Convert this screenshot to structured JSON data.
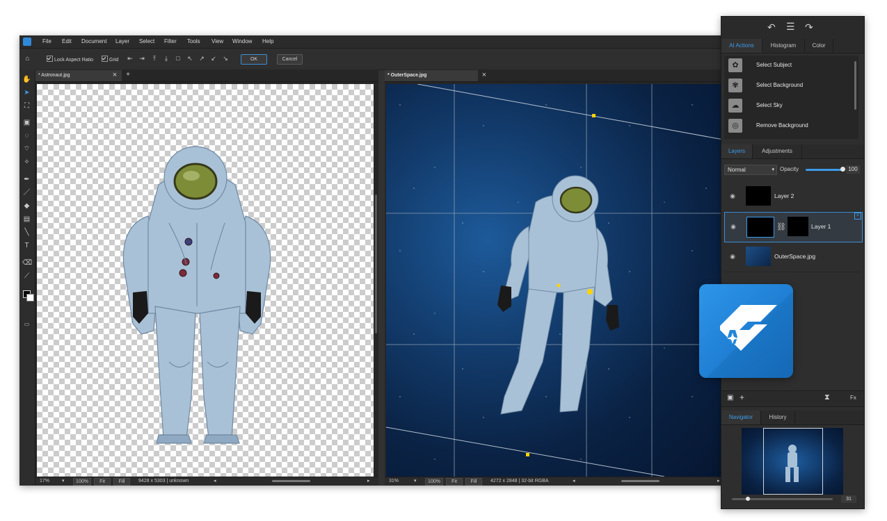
{
  "menubar": {
    "items": [
      "File",
      "Edit",
      "Document",
      "Layer",
      "Select",
      "Filter",
      "Tools",
      "View",
      "Window",
      "Help"
    ]
  },
  "options": {
    "lock_aspect_label": "Lock Aspect Ratio",
    "grid_label": "Grid",
    "ok_label": "OK",
    "cancel_label": "Cancel"
  },
  "docs": {
    "left": {
      "tab_title": "* Astronaut.jpg",
      "zoom": "17%",
      "zoom100": "100%",
      "fit": "Fit",
      "fill": "Fill",
      "info": "9428 x 5303 | unknown"
    },
    "right": {
      "tab_title": "* OuterSpace.jpg",
      "zoom": "31%",
      "zoom100": "100%",
      "fit": "Fit",
      "fill": "Fill",
      "info": "4272 x 2848 | 32-bit RGBA"
    }
  },
  "panel": {
    "top_tabs": [
      "AI Actions",
      "Histogram",
      "Color"
    ],
    "ai_actions": [
      {
        "label": "Select Subject",
        "icon": "select-subject-icon"
      },
      {
        "label": "Select Background",
        "icon": "select-background-icon"
      },
      {
        "label": "Select Sky",
        "icon": "select-sky-icon"
      },
      {
        "label": "Remove Background",
        "icon": "remove-background-icon"
      }
    ],
    "layer_tabs": [
      "Layers",
      "Adjustments"
    ],
    "blend_mode": "Normal",
    "opacity_label": "Opacity",
    "opacity_value": "100",
    "layers": [
      {
        "name": "Layer 2"
      },
      {
        "name": "Layer 1"
      },
      {
        "name": "OuterSpace.jpg"
      }
    ],
    "nav_tabs": [
      "Navigator",
      "History"
    ],
    "nav_zoom": "31"
  },
  "colors": {
    "accent": "#3d9be9",
    "panel_bg": "#2e2e2e",
    "badge": "#2387d9"
  }
}
